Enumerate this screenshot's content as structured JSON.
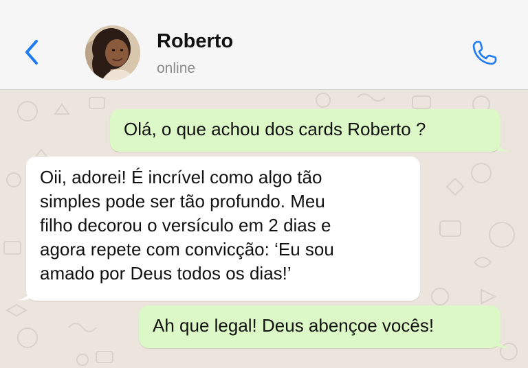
{
  "header": {
    "contact_name": "Roberto",
    "status": "online",
    "accent_color": "#1e7bf2"
  },
  "icons": {
    "back": "chevron-left-icon",
    "call": "phone-icon",
    "avatar": "contact-avatar-photo"
  },
  "messages": [
    {
      "direction": "outgoing",
      "text": "Olá, o que achou dos cards Roberto ?"
    },
    {
      "direction": "incoming",
      "lines": [
        "Oii, adorei! É incrível como algo tão",
        "simples pode ser tão profundo. Meu",
        "filho decorou o versículo em 2 dias e",
        "agora repete com convicção: ‘Eu sou",
        "amado por Deus todos os dias!’"
      ]
    },
    {
      "direction": "outgoing",
      "text": "Ah que legal! Deus abençoe vocês!"
    }
  ],
  "colors": {
    "outgoing_bubble": "#dcf8c6",
    "incoming_bubble": "#ffffff",
    "chat_background": "#ece5dd"
  }
}
